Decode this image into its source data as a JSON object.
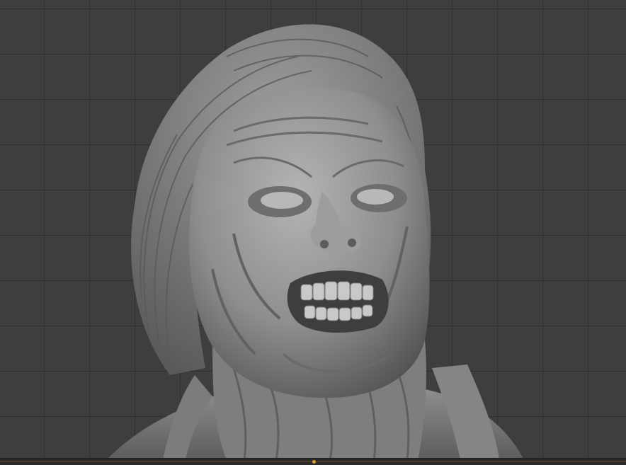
{
  "viewport": {
    "background_color": "#3e3e3e",
    "grid_color": "#2f2f2f",
    "model_icon": "sculpt-bust-mesh",
    "model_color": "#8a8a8a"
  },
  "timeline": {
    "playhead_color": "#e0a030",
    "line_color": "#b0503a"
  }
}
